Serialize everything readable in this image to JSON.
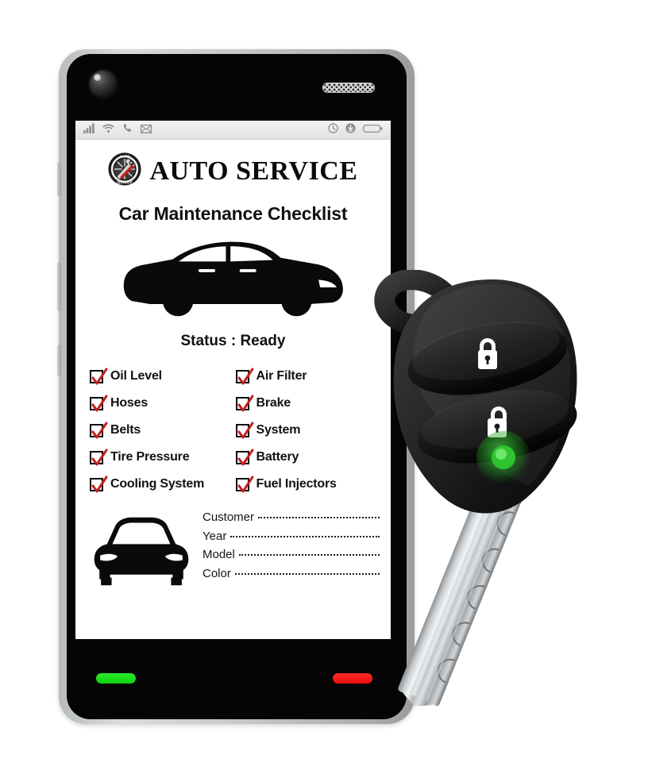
{
  "device": {
    "name": "smartphone",
    "camera_icon": "camera-lens-icon",
    "speaker_icon": "earpiece-speaker-icon",
    "call_button_color": "#17dd17",
    "end_button_color": "#f01212"
  },
  "statusbar": {
    "left_icons": [
      "signal-bars-icon",
      "wifi-icon",
      "phone-icon",
      "mail-icon"
    ],
    "right_icons": [
      "clock-icon",
      "download-icon",
      "battery-icon"
    ]
  },
  "app": {
    "brand": "AUTO SERVICE",
    "logo_icon": "auto-service-badge-logo",
    "logo_top_text": "AUTO",
    "logo_bottom_text": "SERVICE",
    "title": "Car Maintenance Checklist",
    "hero_icon": "car-side-silhouette",
    "status_label": "Status :",
    "status_value": "Ready",
    "status_full": "Status : Ready"
  },
  "checklist": {
    "left_column": [
      {
        "label": "Oil Level",
        "checked": true
      },
      {
        "label": "Hoses",
        "checked": true
      },
      {
        "label": "Belts",
        "checked": true
      },
      {
        "label": "Tire Pressure",
        "checked": true
      },
      {
        "label": "Cooling System",
        "checked": true
      }
    ],
    "right_column": [
      {
        "label": "Air Filter",
        "checked": true
      },
      {
        "label": "Brake",
        "checked": true
      },
      {
        "label": "System",
        "checked": true
      },
      {
        "label": "Battery",
        "checked": true
      },
      {
        "label": "Fuel Injectors",
        "checked": true
      }
    ],
    "check_color": "#c22020"
  },
  "form": {
    "icon": "car-front-silhouette",
    "fields": [
      {
        "label": "Customer",
        "value": ""
      },
      {
        "label": "Year",
        "value": ""
      },
      {
        "label": "Model",
        "value": ""
      },
      {
        "label": "Color",
        "value": ""
      }
    ]
  },
  "key_fob": {
    "name": "car-key-remote",
    "buttons": [
      {
        "icon": "lock-closed-icon",
        "label": "Lock"
      },
      {
        "icon": "lock-open-icon",
        "label": "Unlock"
      }
    ],
    "led_color": "#2fbf2f",
    "led_name": "status-led",
    "blade_name": "key-blade"
  }
}
